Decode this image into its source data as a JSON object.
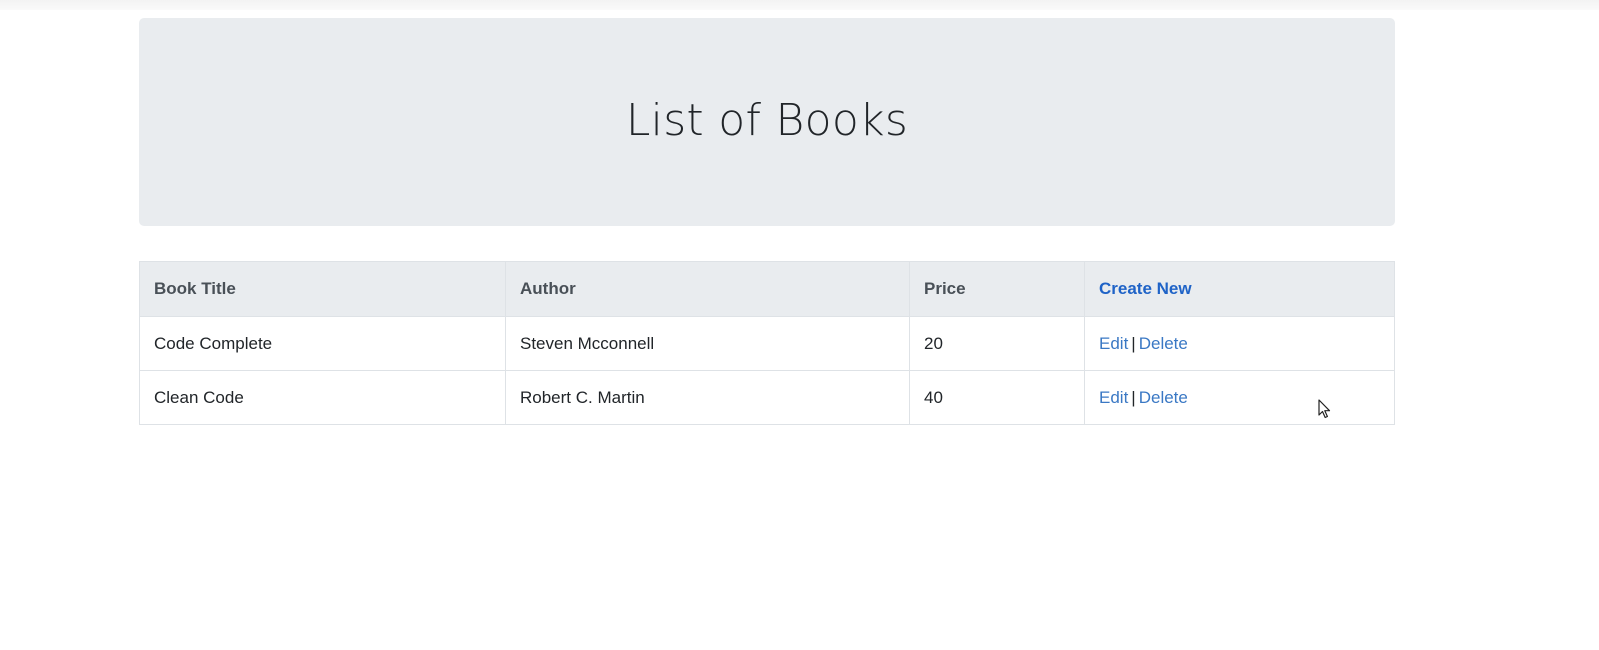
{
  "header": {
    "title": "List of Books"
  },
  "table": {
    "columns": [
      "Book Title",
      "Author",
      "Price"
    ],
    "create_label": "Create New",
    "rows": [
      {
        "title": "Code Complete",
        "author": "Steven Mcconnell",
        "price": "20",
        "edit_label": "Edit",
        "separator": "|",
        "delete_label": "Delete"
      },
      {
        "title": "Clean Code",
        "author": "Robert C. Martin",
        "price": "40",
        "edit_label": "Edit",
        "separator": "|",
        "delete_label": "Delete"
      }
    ]
  },
  "colors": {
    "header_bg": "#e9ecef",
    "link": "#3a78c4",
    "create_link": "#1f63c7"
  },
  "icons": {
    "cursor": "mouse-pointer-icon"
  }
}
